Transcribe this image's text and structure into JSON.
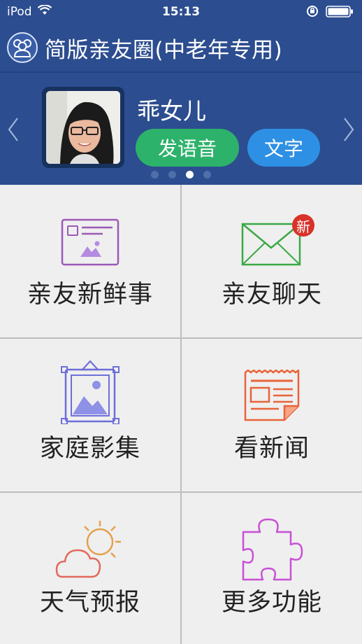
{
  "status_bar": {
    "carrier": "iPod",
    "time": "15:13"
  },
  "header": {
    "title": "简版亲友圈(中老年专用)"
  },
  "profile": {
    "name": "乖女儿",
    "voice_button": "发语音",
    "text_button": "文字",
    "page_count": 4,
    "active_page": 3
  },
  "tiles": [
    {
      "label": "亲友新鲜事",
      "icon": "news-feed-card-icon"
    },
    {
      "label": "亲友聊天",
      "icon": "envelope-icon",
      "badge": "新"
    },
    {
      "label": "家庭影集",
      "icon": "framed-picture-icon"
    },
    {
      "label": "看新闻",
      "icon": "newspaper-icon"
    },
    {
      "label": "天气预报",
      "icon": "sun-cloud-icon"
    },
    {
      "label": "更多功能",
      "icon": "puzzle-piece-icon"
    }
  ],
  "colors": {
    "header_bg": "#2c4d8f",
    "voice_btn": "#2db26b",
    "text_btn": "#2e90e4",
    "badge": "#d9322a"
  }
}
